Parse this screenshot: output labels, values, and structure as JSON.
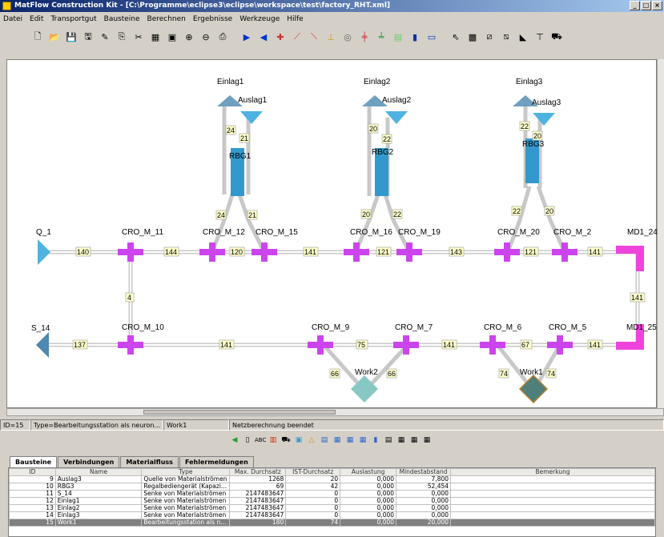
{
  "window": {
    "title": "MatFlow Construction Kit - [C:\\Programme\\eclipse3\\eclipse\\workspace\\test\\factory_RHT.xml]"
  },
  "menu": [
    "Datei",
    "Edit",
    "Transportgut",
    "Bausteine",
    "Berechnen",
    "Ergebnisse",
    "Werkzeuge",
    "Hilfe"
  ],
  "nodes": {
    "Einlag1": "Einlag1",
    "Auslag1": "Auslag1",
    "RBG1": "RBG1",
    "Einlag2": "Einlag2",
    "Auslag2": "Auslag2",
    "RBG2": "RBG2",
    "Einlag3": "Einlag3",
    "Auslag3": "Auslag3",
    "RBG3": "RBG3",
    "Q_1": "Q_1",
    "S_14": "S_14",
    "CRO_M_11": "CRO_M_11",
    "CRO_M_12": "CRO_M_12",
    "CRO_M_15": "CRO_M_15",
    "CRO_M_16": "CRO_M_16",
    "CRO_M_19": "CRO_M_19",
    "CRO_M_20": "CRO_M_20",
    "CRO_M_2": "CRO_M_2",
    "MD1_24": "MD1_24",
    "CRO_M_10": "CRO_M_10",
    "CRO_M_9": "CRO_M_9",
    "CRO_M_7": "CRO_M_7",
    "CRO_M_6": "CRO_M_6",
    "CRO_M_5": "CRO_M_5",
    "MD1_25": "MD1_25",
    "Work1": "Work1",
    "Work2": "Work2"
  },
  "edge_labels": {
    "e24a": "24",
    "e21a": "21",
    "e24b": "24",
    "e21b": "21",
    "e20a": "20",
    "e22a": "22",
    "e20b": "20",
    "e22b": "22",
    "e22c": "22",
    "e20c": "20",
    "e22d": "22",
    "e20d": "20",
    "e140": "140",
    "e144": "144",
    "e120": "120",
    "e141a": "141",
    "e121a": "121",
    "e143": "143",
    "e121b": "121",
    "e141b": "141",
    "e4": "4",
    "e141v": "141",
    "e137": "137",
    "e141c": "141",
    "e75": "75",
    "e141d": "141",
    "e67": "67",
    "e141e": "141",
    "e66a": "66",
    "e66b": "66",
    "e74a": "74",
    "e74b": "74"
  },
  "status": {
    "id": "ID=15",
    "type": "Type=Bearbeitungsstation als neuron...",
    "name": "Work1",
    "msg": "Netzberechnung beendet"
  },
  "tabs": [
    "Bausteine",
    "Verbindungen",
    "Materialfluss",
    "Fehlermeldungen"
  ],
  "table": {
    "headers": [
      "ID",
      "Name",
      "Type",
      "Max. Durchsatz",
      "IST-Durchsatz",
      "Auslastung",
      "Mindestabstand",
      "Bemerkung"
    ],
    "rows": [
      [
        "9",
        "Auslag3",
        "Quelle von Materialströmen",
        "1268",
        "20",
        "0,000",
        "7,800",
        ""
      ],
      [
        "10",
        "RBG3",
        "Regalbediengerät (Kapazi...",
        "69",
        "42",
        "0,000",
        "52,454",
        ""
      ],
      [
        "11",
        "S_14",
        "Senke von Materialströmen",
        "2147483647",
        "0",
        "0,000",
        "0,000",
        ""
      ],
      [
        "12",
        "Einlag1",
        "Senke von Materialströmen",
        "2147483647",
        "0",
        "0,000",
        "0,000",
        ""
      ],
      [
        "13",
        "Einlag2",
        "Senke von Materialströmen",
        "2147483647",
        "0",
        "0,000",
        "0,000",
        ""
      ],
      [
        "14",
        "Einlag3",
        "Senke von Materialströmen",
        "2147483647",
        "0",
        "0,000",
        "0,000",
        ""
      ],
      [
        "15",
        "Work1",
        "Bearbeitungsstation als n...",
        "180",
        "74",
        "0,000",
        "20,000",
        ""
      ]
    ]
  },
  "colors": {
    "cross": "#cc44ee",
    "conveyor": "#3399cc",
    "source": "#4eb3e0",
    "merge": "#ee44dd",
    "work1": "#4f7f7a",
    "work2": "#88c8c4"
  }
}
